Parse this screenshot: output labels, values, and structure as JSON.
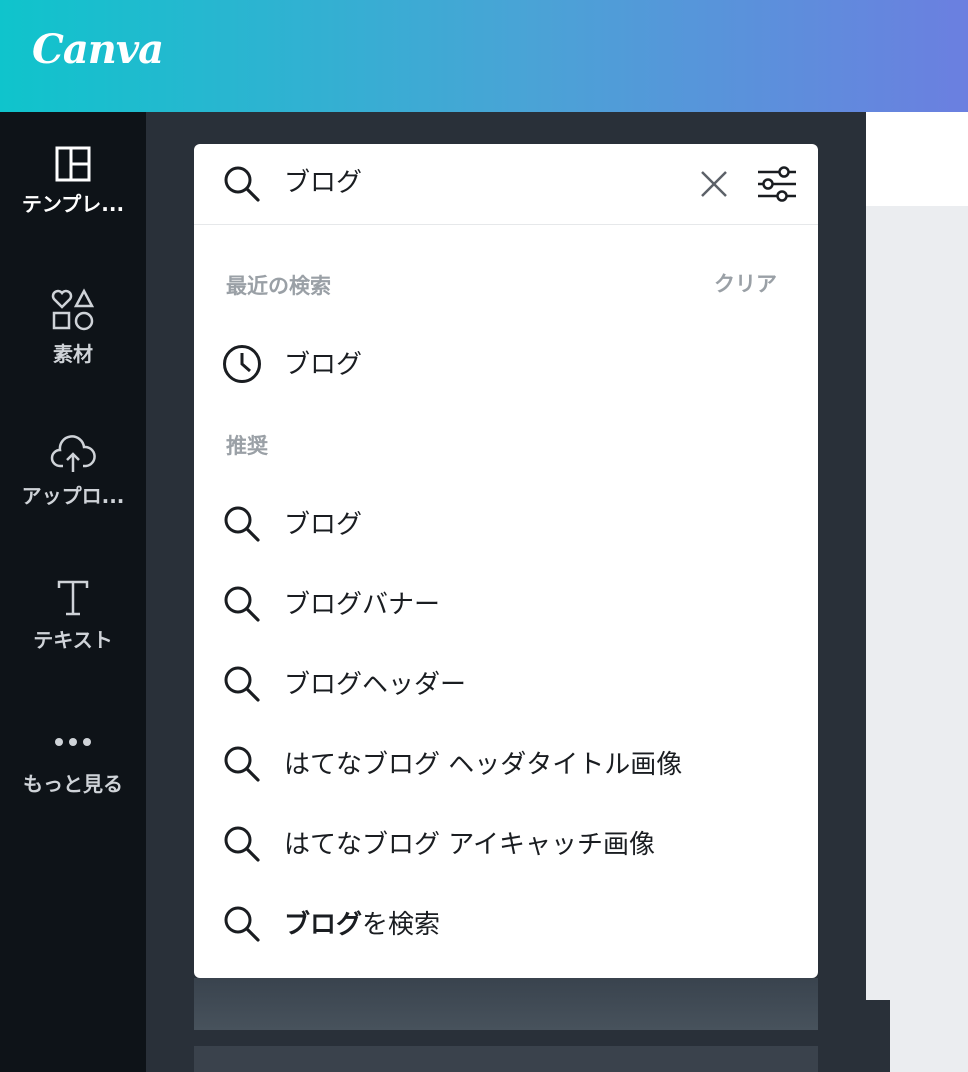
{
  "header": {
    "logo": "Canva"
  },
  "sidebar": {
    "items": [
      {
        "label": "テンプレ..."
      },
      {
        "label": "素材"
      },
      {
        "label": "アップロ..."
      },
      {
        "label": "テキスト"
      },
      {
        "label": "もっと見る"
      }
    ]
  },
  "search": {
    "query": "ブログ",
    "recent_title": "最近の検索",
    "clear_label": "クリア",
    "recent": [
      "ブログ"
    ],
    "suggest_title": "推奨",
    "suggestions": [
      "ブログ",
      "ブログバナー",
      "ブログヘッダー",
      "はてなブログ ヘッダタイトル画像",
      "はてなブログ アイキャッチ画像"
    ],
    "search_for_term": "ブログ",
    "search_for_suffix": "を検索"
  },
  "colors": {
    "header_start": "#0fc4cc",
    "header_end": "#6b7fe0",
    "rail": "#0e1318",
    "panel": "#293039"
  }
}
